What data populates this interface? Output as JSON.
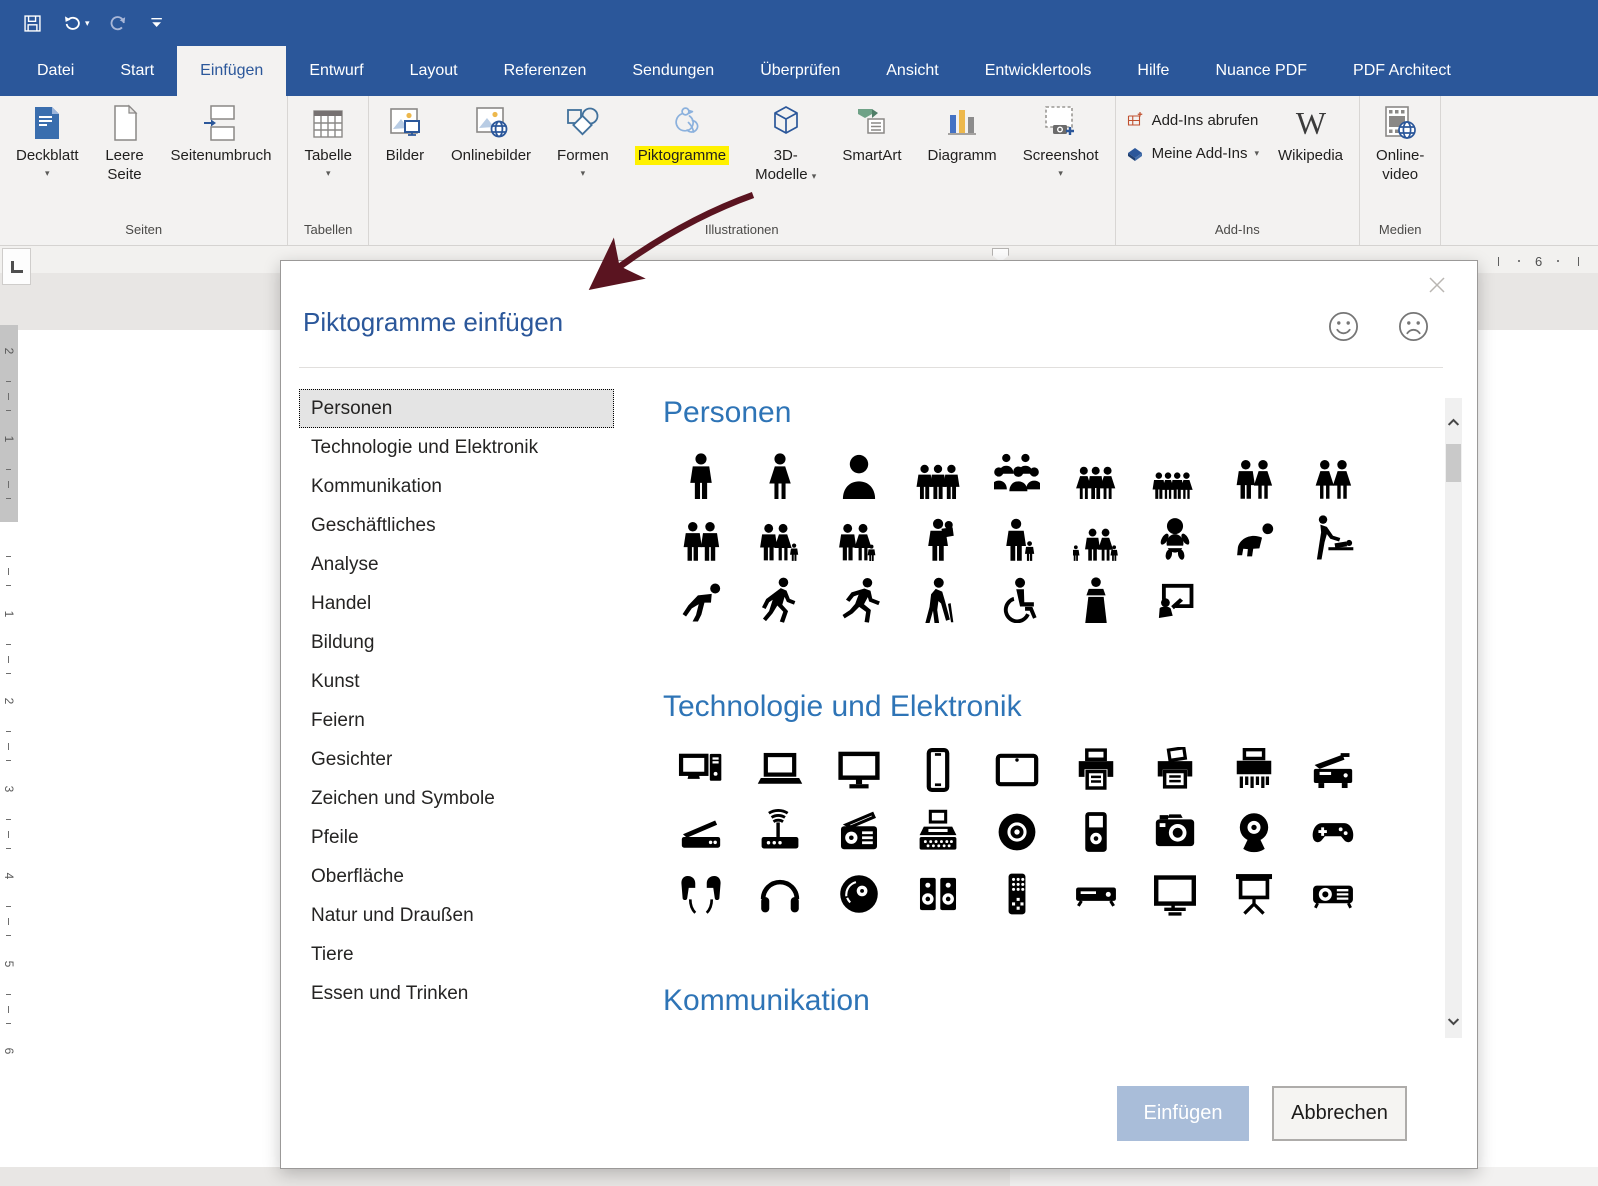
{
  "colors": {
    "accent_blue": "#2b579a",
    "heading_blue": "#2e74b6",
    "highlight_yellow": "#fff100",
    "arrow_maroon": "#5a1420",
    "insert_disabled_bg": "#a9bdd9"
  },
  "quick_access": [
    {
      "name": "save",
      "dropdown": false
    },
    {
      "name": "undo",
      "dropdown": true
    },
    {
      "name": "redo",
      "dropdown": false
    },
    {
      "name": "customize-toolbar",
      "dropdown": false
    }
  ],
  "ribbon": {
    "tabs": [
      {
        "label": "Datei",
        "active": false
      },
      {
        "label": "Start",
        "active": false
      },
      {
        "label": "Einfügen",
        "active": true
      },
      {
        "label": "Entwurf",
        "active": false
      },
      {
        "label": "Layout",
        "active": false
      },
      {
        "label": "Referenzen",
        "active": false
      },
      {
        "label": "Sendungen",
        "active": false
      },
      {
        "label": "Überprüfen",
        "active": false
      },
      {
        "label": "Ansicht",
        "active": false
      },
      {
        "label": "Entwicklertools",
        "active": false
      },
      {
        "label": "Hilfe",
        "active": false
      },
      {
        "label": "Nuance PDF",
        "active": false
      },
      {
        "label": "PDF Architect",
        "active": false
      }
    ],
    "groups": [
      {
        "label": "Seiten",
        "buttons": [
          {
            "label": "Deckblatt",
            "icon": "cover-page",
            "dropdown": true
          },
          {
            "label": "Leere Seite",
            "lines": [
              "Leere",
              "Seite"
            ],
            "icon": "blank-page",
            "dropdown": false
          },
          {
            "label": "Seitenumbruch",
            "icon": "page-break",
            "dropdown": false
          }
        ]
      },
      {
        "label": "Tabellen",
        "buttons": [
          {
            "label": "Tabelle",
            "icon": "table",
            "dropdown": true
          }
        ]
      },
      {
        "label": "Illustrationen",
        "buttons": [
          {
            "label": "Bilder",
            "icon": "pictures",
            "dropdown": false
          },
          {
            "label": "Onlinebilder",
            "icon": "online-pictures",
            "dropdown": false
          },
          {
            "label": "Formen",
            "icon": "shapes",
            "dropdown": true
          },
          {
            "label": "Piktogramme",
            "icon": "icons",
            "dropdown": false,
            "highlighted": true
          },
          {
            "label": "3D-Modelle",
            "lines": [
              "3D-",
              "Modelle"
            ],
            "icon": "3d-models",
            "dropdown": true
          },
          {
            "label": "SmartArt",
            "icon": "smartart",
            "dropdown": false
          },
          {
            "label": "Diagramm",
            "icon": "chart",
            "dropdown": false
          },
          {
            "label": "Screenshot",
            "icon": "screenshot",
            "dropdown": true
          }
        ]
      },
      {
        "label": "Add-Ins",
        "small_buttons": [
          {
            "label": "Add-Ins abrufen",
            "icon": "store",
            "dropdown": false
          },
          {
            "label": "Meine Add-Ins",
            "icon": "my-add-ins",
            "dropdown": true
          }
        ],
        "buttons": [
          {
            "label": "Wikipedia",
            "icon": "wikipedia",
            "dropdown": false
          }
        ]
      },
      {
        "label": "Medien",
        "buttons": [
          {
            "label": "Online-video",
            "lines": [
              "Online-",
              "video"
            ],
            "icon": "online-video",
            "dropdown": false
          }
        ]
      }
    ]
  },
  "annotation": {
    "type": "arrow",
    "color": "#5a1420",
    "points_at": "Piktogramme"
  },
  "rulers": {
    "vertical_labels": [
      "2",
      "1",
      "",
      "1",
      "2",
      "3",
      "4",
      "5",
      "6"
    ],
    "horizontal_visible_number": "6"
  },
  "dialog": {
    "title": "Piktogramme einfügen",
    "feedback_icons": [
      "smiley-happy",
      "smiley-sad"
    ],
    "categories": [
      "Personen",
      "Technologie und Elektronik",
      "Kommunikation",
      "Geschäftliches",
      "Analyse",
      "Handel",
      "Bildung",
      "Kunst",
      "Feiern",
      "Gesichter",
      "Zeichen und Symbole",
      "Pfeile",
      "Oberfläche",
      "Natur und Draußen",
      "Tiere",
      "Essen und Trinken"
    ],
    "selected_category": "Personen",
    "sections": [
      {
        "heading": "Personen",
        "icon_rows": [
          [
            "man",
            "woman",
            "person-bust",
            "group-three-men",
            "people-crowd",
            "group-three-mixed",
            "group-four-people",
            "couple",
            "couple-women"
          ],
          [
            "couple-men",
            "family-with-child",
            "family-holding-child",
            "parent-carrying-baby",
            "parent-with-child",
            "family-two-children",
            "baby",
            "baby-crawling",
            "baby-changing-table"
          ],
          [
            "person-crouching",
            "person-walking",
            "person-running",
            "elderly-with-cane",
            "wheelchair-user",
            "speaker-at-podium",
            "presenter-whiteboard"
          ]
        ]
      },
      {
        "heading": "Technologie und Elektronik",
        "icon_rows": [
          [
            "desktop-computer",
            "laptop",
            "monitor",
            "smartphone",
            "tablet",
            "printer",
            "fax-machine",
            "shredder",
            "copier"
          ],
          [
            "scanner",
            "wifi-router",
            "radio",
            "typewriter",
            "cd",
            "portable-media-player",
            "camera",
            "webcam",
            "game-controller"
          ],
          [
            "earbuds",
            "headphones",
            "vinyl-record",
            "speakers",
            "remote-control",
            "dvd-player",
            "television",
            "projection-screen",
            "projector"
          ]
        ]
      },
      {
        "heading": "Kommunikation",
        "icon_rows": []
      }
    ],
    "insert_button": {
      "label": "Einfügen",
      "enabled": false
    },
    "cancel_button": {
      "label": "Abbrechen"
    }
  }
}
